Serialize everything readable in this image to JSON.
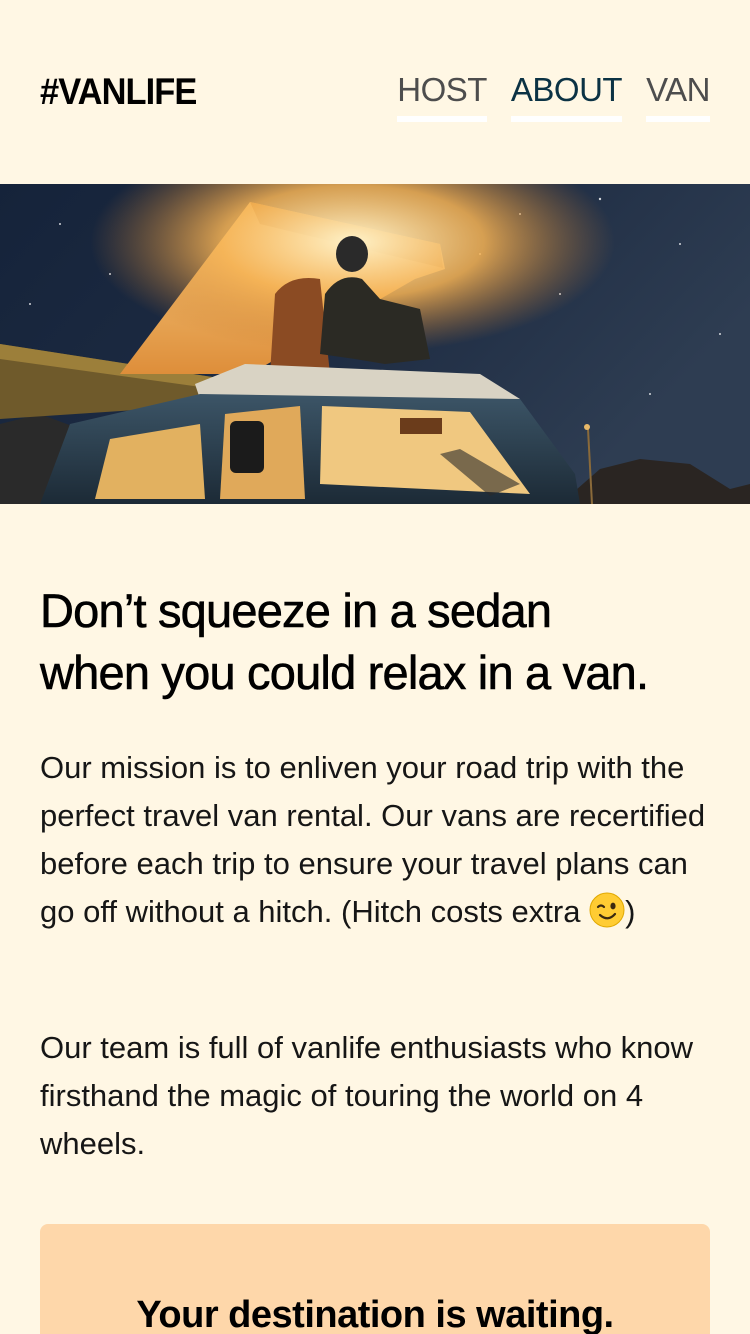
{
  "header": {
    "logo": "#VANLIFE",
    "nav": [
      {
        "label": "HOST",
        "active": false
      },
      {
        "label": "ABOUT",
        "active": true
      },
      {
        "label": "VAN",
        "active": false
      }
    ]
  },
  "hero": {
    "image": "van-at-night-photo"
  },
  "main": {
    "headline_line1": "Don’t squeeze in a sedan",
    "headline_line2": "when you could relax in a van.",
    "paragraph1": "Our mission is to enliven your road trip with the perfect travel van rental. Our vans are recertified before each trip to ensure your travel plans can go off without a hitch. (Hitch costs extra",
    "paragraph1_end": ")",
    "paragraph1_emoji": "winking-face-icon",
    "paragraph2": "Our team is full of vanlife enthusiasts who know firsthand the magic of touring the world on 4 wheels."
  },
  "cta": {
    "title": "Your destination is waiting."
  },
  "colors": {
    "background": "#FFF7E4",
    "cta_background": "#FED7AA",
    "nav_active": "#0B3244",
    "nav_inactive": "#4D4D4D"
  }
}
